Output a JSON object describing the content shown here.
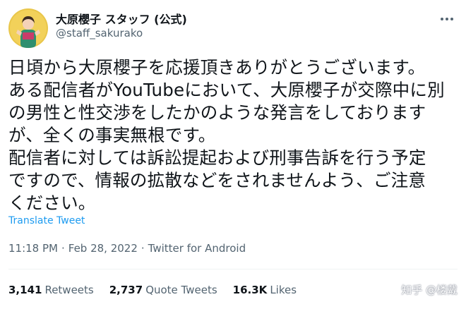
{
  "author": {
    "display_name": "大原櫻子 スタッフ (公式)",
    "handle": "@staff_sakurako",
    "avatar": "avatar-photo"
  },
  "tweet": {
    "lines": [
      "日頃から大原櫻子を応援頂きありがとうございます。",
      "ある配信者がYouTubeにおいて、大原櫻子が交際中に別",
      "の男性と性交渉をしたかのような発言をしております",
      "が、全くの事実無根です。",
      "配信者に対しては訴訟提起および刑事告訴を行う予定",
      "ですので、情報の拡散などをされませんよう、ご注意",
      "ください。"
    ],
    "translate_label": "Translate Tweet"
  },
  "meta": {
    "time": "11:18 PM",
    "date": "Feb 28, 2022",
    "source": "Twitter for Android",
    "separator": "·"
  },
  "stats": {
    "retweets_count": "3,141",
    "retweets_label": "Retweets",
    "quotes_count": "2,737",
    "quotes_label": "Quote Tweets",
    "likes_count": "16.3K",
    "likes_label": "Likes"
  },
  "watermark": {
    "text": "知乎 @楼戴",
    "icon": "zhihu-logo-icon"
  },
  "colors": {
    "text": "#0f1419",
    "secondary": "#536471",
    "link": "#1d9bf0",
    "divider": "#eff3f4"
  }
}
